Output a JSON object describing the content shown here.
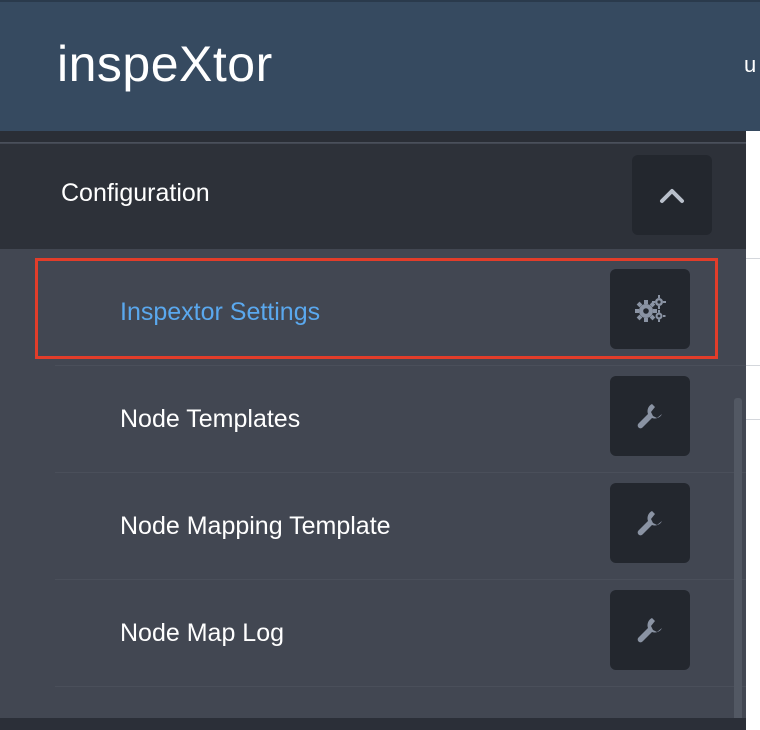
{
  "header": {
    "brand": "inspeXtor",
    "clipped_text": "u"
  },
  "sidebar": {
    "section": {
      "title": "Configuration",
      "collapse_icon": "chevron-up-icon",
      "expanded": true
    },
    "items": [
      {
        "label": "Inspextor Settings",
        "icon": "gears-icon",
        "active": true
      },
      {
        "label": "Node Templates",
        "icon": "wrench-icon",
        "active": false
      },
      {
        "label": "Node Mapping Template",
        "icon": "wrench-icon",
        "active": false
      },
      {
        "label": "Node Map Log",
        "icon": "wrench-icon",
        "active": false
      }
    ]
  },
  "colors": {
    "header_bg": "#364a60",
    "sidebar_bg": "#424752",
    "section_bg": "#2d3139",
    "button_bg": "#23272e",
    "active_text": "#5aa8ee",
    "highlight_border": "#e23d2a",
    "icon_color": "#8a93a3"
  }
}
